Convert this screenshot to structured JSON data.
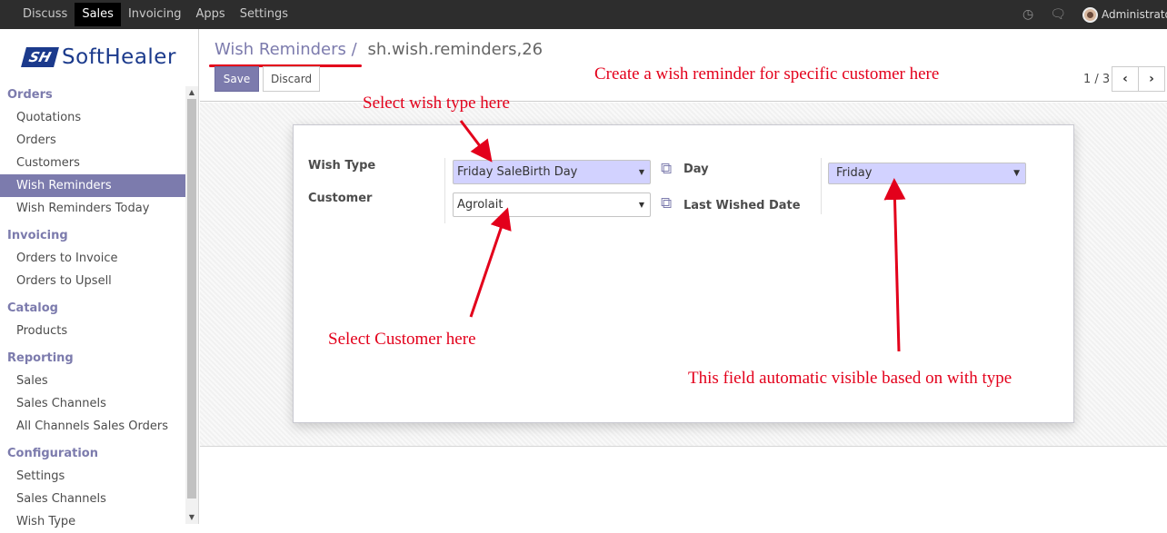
{
  "topbar": {
    "menu": [
      "Discuss",
      "Sales",
      "Invoicing",
      "Apps",
      "Settings"
    ],
    "active": "Sales",
    "user": "Administrator",
    "icons": [
      "clock-icon",
      "chat-icon"
    ]
  },
  "logo": {
    "mark": "SH",
    "text": "SoftHealer"
  },
  "sidebar": {
    "sections": [
      {
        "title": "Orders",
        "items": [
          "Quotations",
          "Orders",
          "Customers",
          "Wish Reminders",
          "Wish Reminders Today"
        ]
      },
      {
        "title": "Invoicing",
        "items": [
          "Orders to Invoice",
          "Orders to Upsell"
        ]
      },
      {
        "title": "Catalog",
        "items": [
          "Products"
        ]
      },
      {
        "title": "Reporting",
        "items": [
          "Sales",
          "Sales Channels",
          "All Channels Sales Orders"
        ]
      },
      {
        "title": "Configuration",
        "items": [
          "Settings",
          "Sales Channels",
          "Wish Type"
        ]
      }
    ],
    "active_item": "Wish Reminders"
  },
  "breadcrumb": {
    "parent": "Wish Reminders",
    "separator": "/",
    "current": "sh.wish.reminders,26"
  },
  "buttons": {
    "save": "Save",
    "discard": "Discard"
  },
  "pager": {
    "value": "1 / 3",
    "prev": "‹",
    "next": "›"
  },
  "form": {
    "wish_type_label": "Wish Type",
    "wish_type_value": "Friday SaleBirth Day",
    "customer_label": "Customer",
    "customer_value": "Agrolait",
    "day_label": "Day",
    "day_value": "Friday",
    "last_wished_label": "Last Wished Date"
  },
  "annotations": {
    "top": "Create a wish reminder for  specific customer here",
    "wish_type": "Select wish type here",
    "customer": "Select Customer here",
    "day": "This field automatic visible based on with type"
  },
  "colors": {
    "accent": "#7c7bad",
    "annotation": "#e3001b",
    "topbar": "#2d2d2d"
  }
}
